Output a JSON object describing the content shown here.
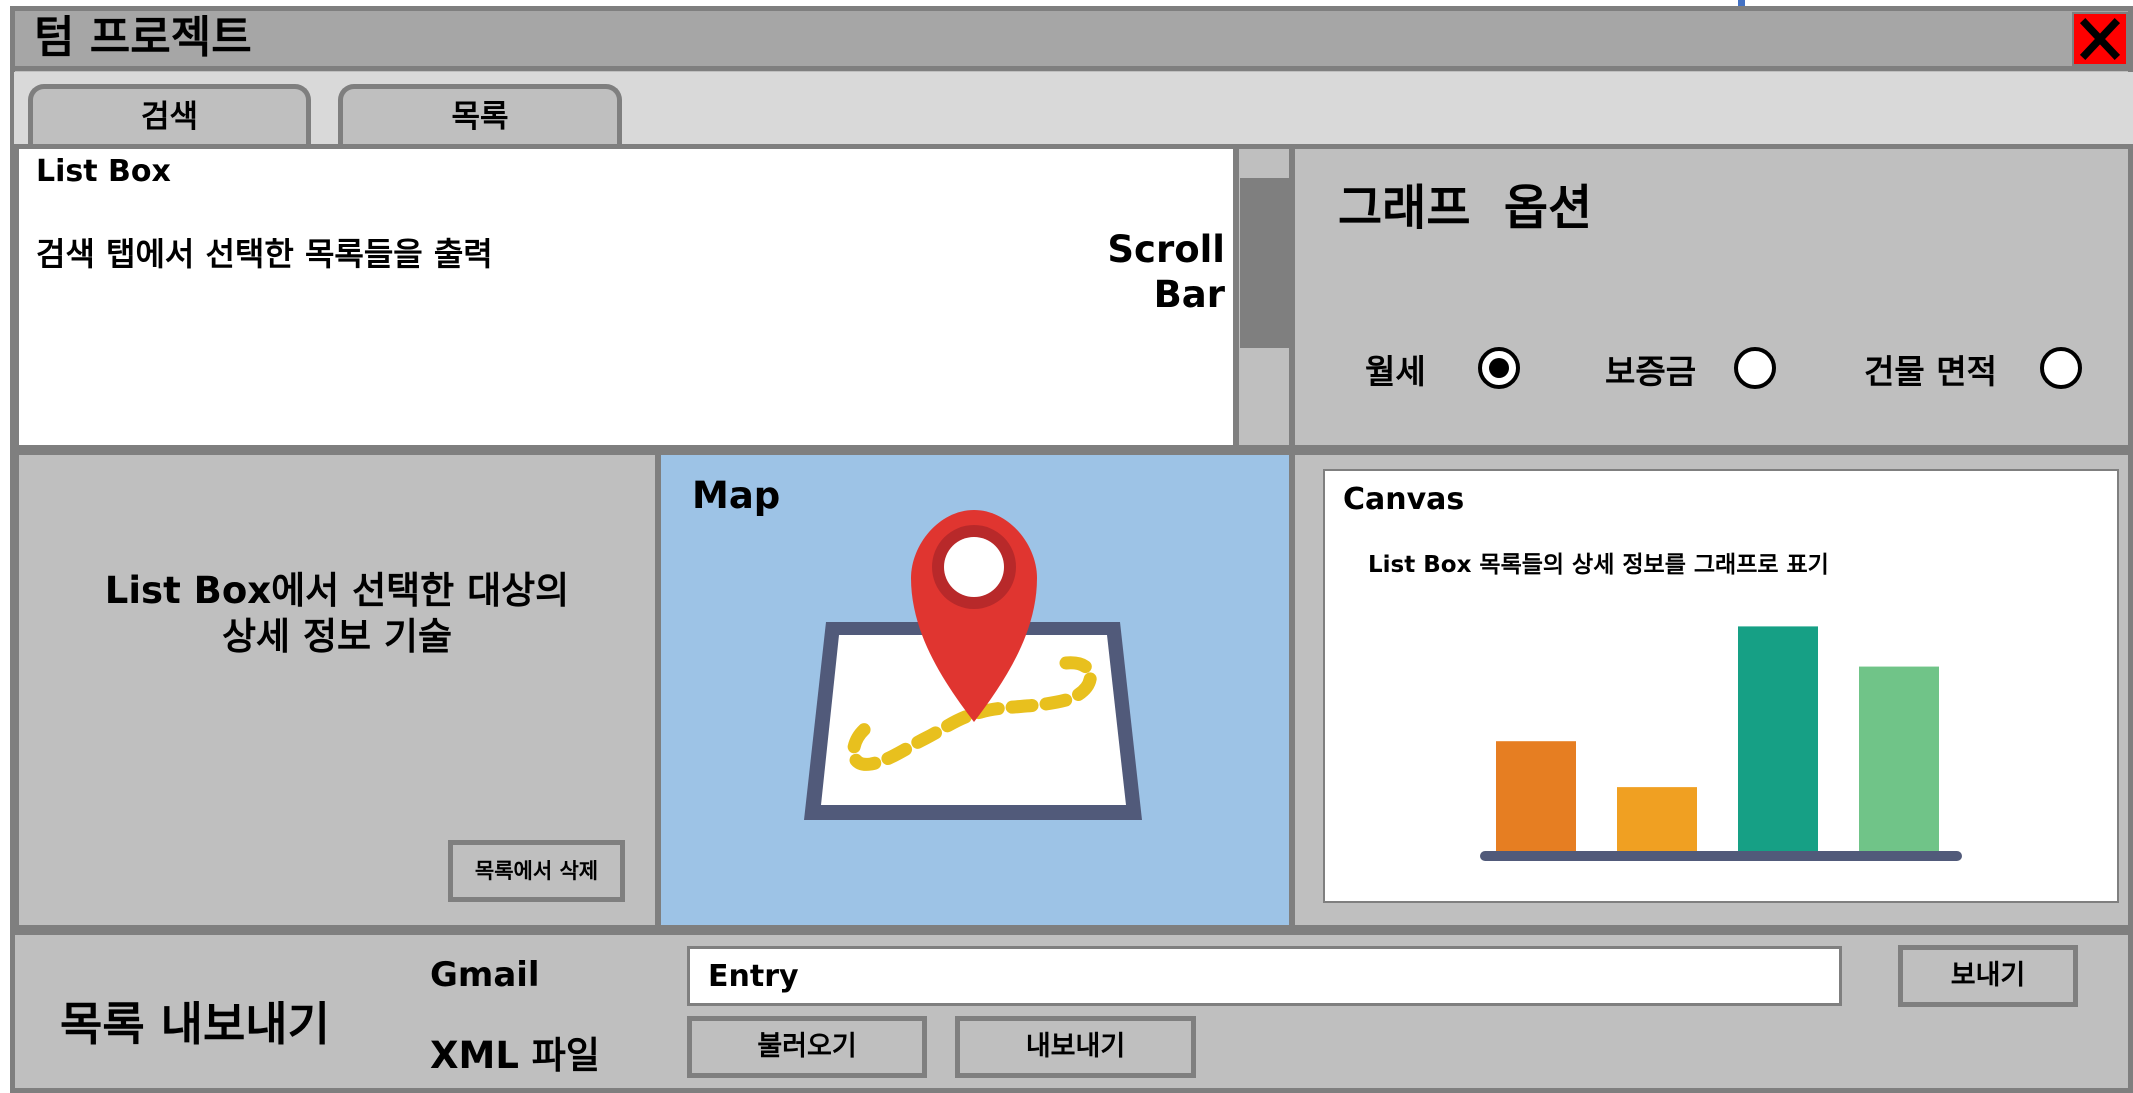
{
  "window": {
    "title": "텀 프로젝트"
  },
  "tabs": [
    {
      "label": "검색"
    },
    {
      "label": "목록"
    }
  ],
  "list_box": {
    "title": "List Box",
    "description": "검색 탭에서 선택한 목록들을 출력",
    "scrollbar_label": "Scroll Bar"
  },
  "graph_options": {
    "title": "그래프  옵션",
    "options": [
      {
        "label": "월세",
        "selected": true
      },
      {
        "label": "보증금",
        "selected": false
      },
      {
        "label": "건물 면적",
        "selected": false
      }
    ]
  },
  "detail": {
    "line1": "List Box에서 선택한 대상의",
    "line2": "상세 정보 기술",
    "delete_label": "목록에서 삭제"
  },
  "map": {
    "title": "Map",
    "icon": "map-pin-icon"
  },
  "canvas": {
    "title": "Canvas",
    "description": "List Box 목록들의 상세 정보를 그래프로 표기",
    "chart_data": {
      "type": "bar",
      "categories": [
        "",
        "",
        "",
        ""
      ],
      "values": [
        40,
        24,
        80,
        66
      ],
      "colors": [
        "#e67e22",
        "#f0a022",
        "#16a085",
        "#70c488"
      ],
      "axis_color": "#515a7a",
      "ylim": [
        0,
        100
      ]
    }
  },
  "export": {
    "title": "목록 내보내기",
    "gmail_label": "Gmail",
    "xml_label": "XML 파일",
    "entry_placeholder": "Entry",
    "send_label": "보내기",
    "load_label": "불러오기",
    "export_label": "내보내기"
  },
  "colors": {
    "window_bg": "#bfbfbf",
    "title_bg": "#a6a6a6",
    "border": "#7f7f7f",
    "close_red": "#ff0000",
    "map_bg": "#9dc3e6",
    "pin_red": "#e03530"
  }
}
